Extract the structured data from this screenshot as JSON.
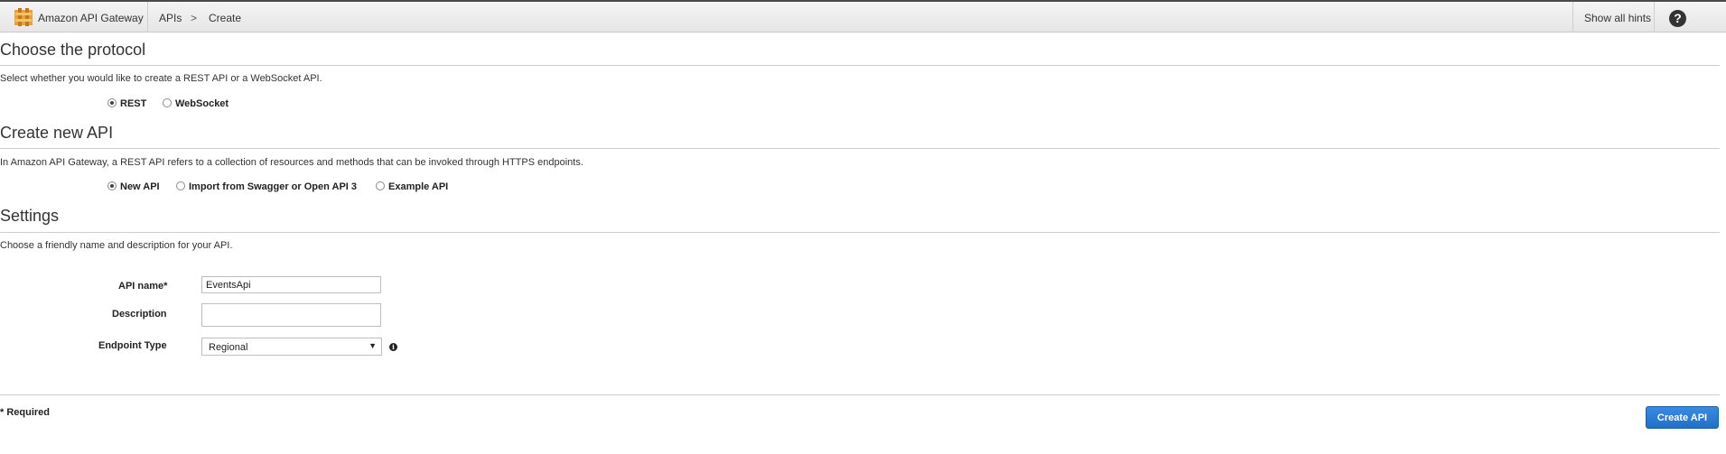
{
  "header": {
    "brand": "Amazon API Gateway",
    "breadcrumb": {
      "parent": "APIs",
      "separator": ">",
      "current": "Create"
    },
    "hints_label": "Show all hints",
    "help_glyph": "?",
    "logo_icon": "api-gateway-logo-icon",
    "help_icon": "question-circle-icon"
  },
  "protocol": {
    "title": "Choose the protocol",
    "description": "Select whether you would like to create a REST API or a WebSocket API.",
    "options": [
      {
        "label": "REST",
        "checked": true
      },
      {
        "label": "WebSocket",
        "checked": false
      }
    ]
  },
  "create_api": {
    "title": "Create new API",
    "description": "In Amazon API Gateway, a REST API refers to a collection of resources and methods that can be invoked through HTTPS endpoints.",
    "options": [
      {
        "label": "New API",
        "checked": true
      },
      {
        "label": "Import from Swagger or Open API 3",
        "checked": false
      },
      {
        "label": "Example API",
        "checked": false
      }
    ]
  },
  "settings": {
    "title": "Settings",
    "description": "Choose a friendly name and description for your API.",
    "api_name": {
      "label": "API name*",
      "value": "EventsApi"
    },
    "description_field": {
      "label": "Description",
      "value": ""
    },
    "endpoint_type": {
      "label": "Endpoint Type",
      "selected": "Regional",
      "arrow": "▼",
      "info_glyph": "i"
    }
  },
  "footer": {
    "required_note": "* Required",
    "create_button": "Create API"
  },
  "colors": {
    "primary_button": "#1f6fc9",
    "header_border": "#4a4a4a"
  }
}
